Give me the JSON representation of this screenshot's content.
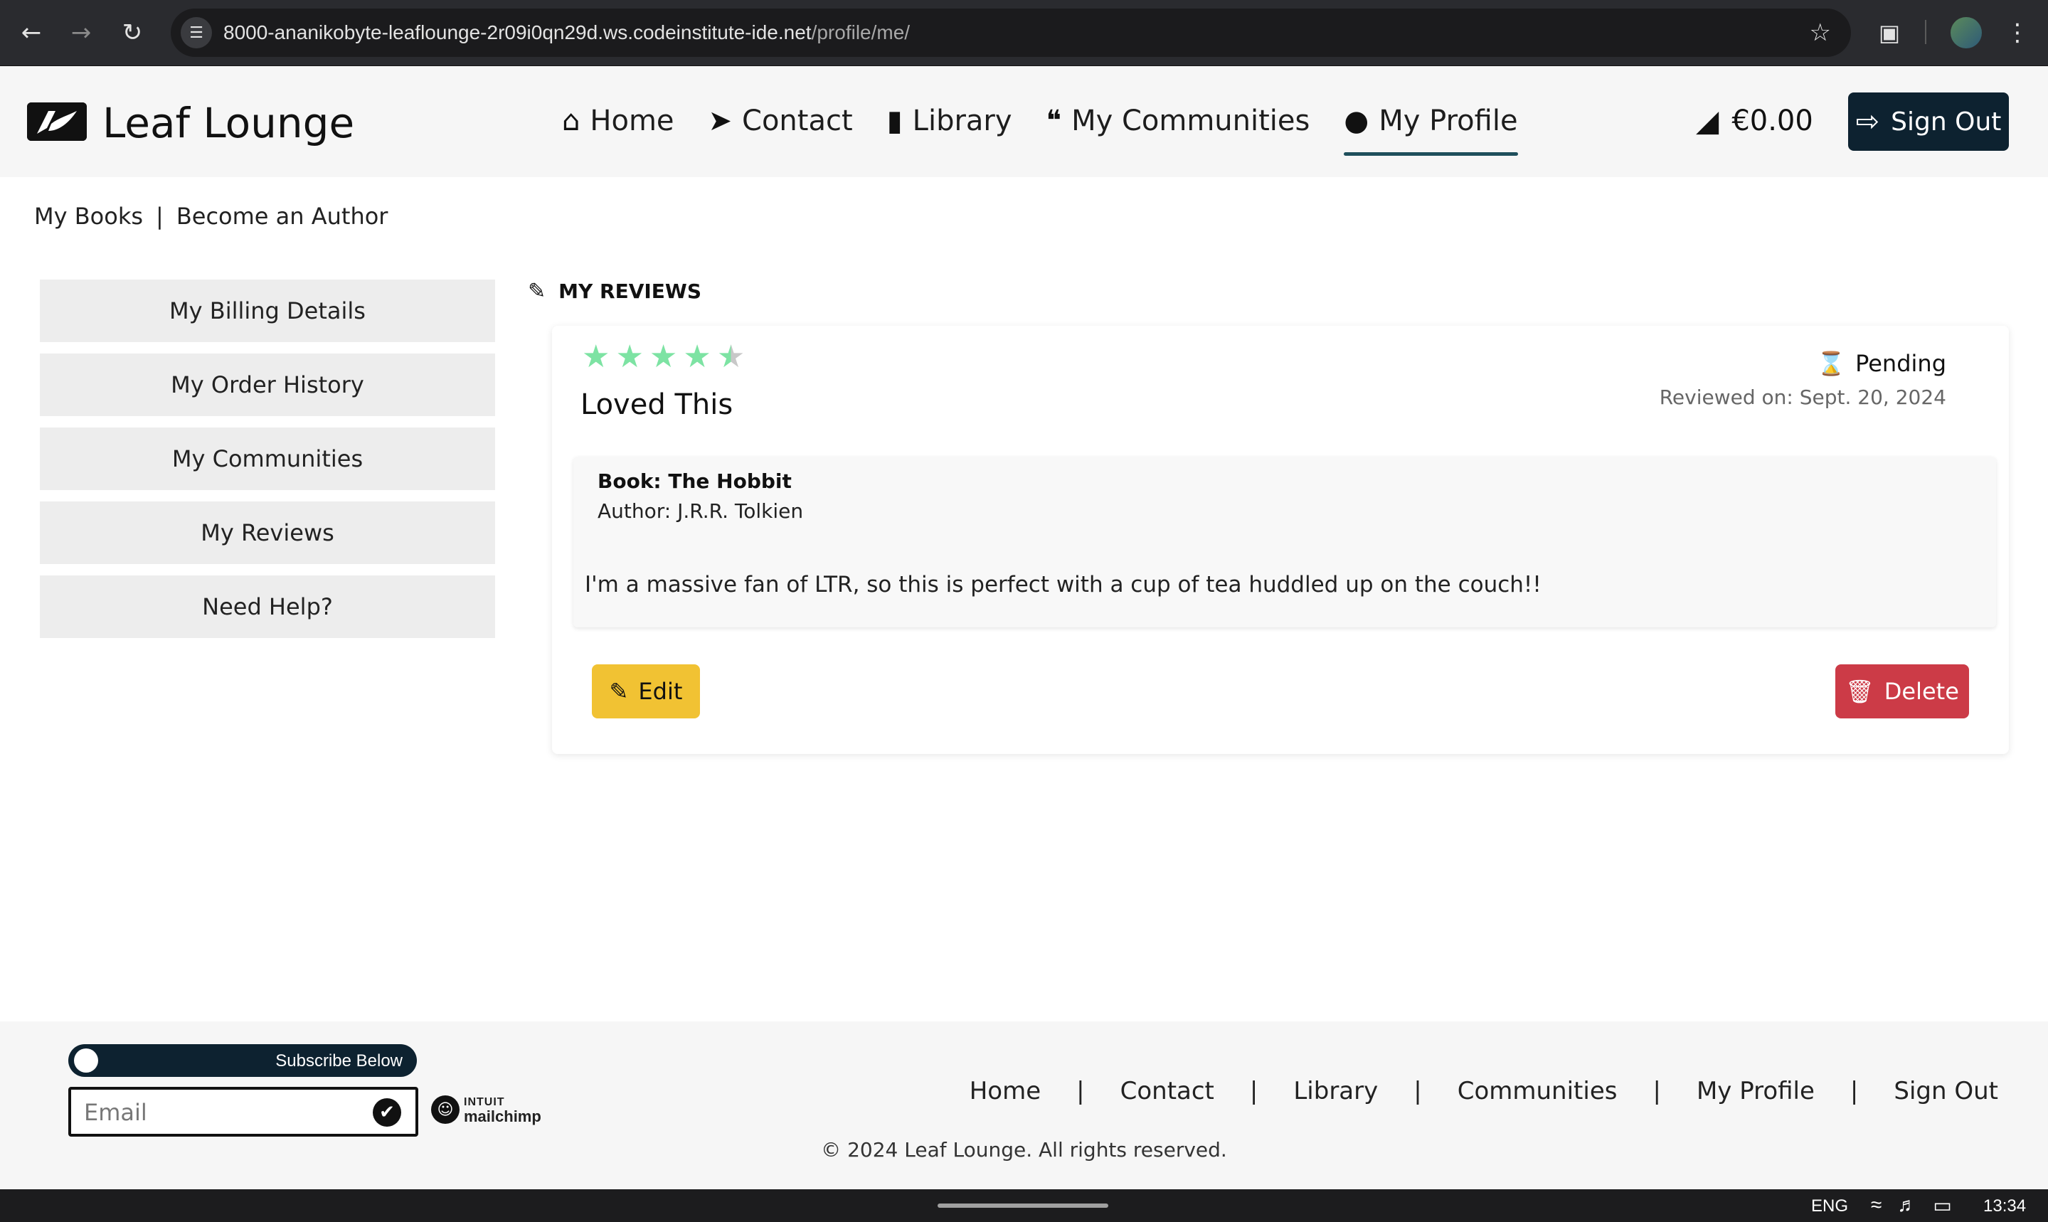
{
  "browser": {
    "url_host": "8000-ananikobyte-leaflounge-2r09i0qn29d.ws.codeinstitute-ide.net",
    "url_path": "/profile/me/"
  },
  "header": {
    "site_name": "Leaf Lounge",
    "nav": [
      {
        "label": "Home",
        "icon": "home-icon"
      },
      {
        "label": "Contact",
        "icon": "paper-plane-icon"
      },
      {
        "label": "Library",
        "icon": "book-icon"
      },
      {
        "label": "My Communities",
        "icon": "comments-icon"
      },
      {
        "label": "My Profile",
        "icon": "user-icon",
        "active": true
      }
    ],
    "cart_total": "€0.00",
    "signout_label": "Sign Out"
  },
  "subnav": {
    "my_books": "My Books",
    "separator": "|",
    "become_author": "Become an Author"
  },
  "sidebar": {
    "items": [
      {
        "label": "My Billing Details"
      },
      {
        "label": "My Order History"
      },
      {
        "label": "My Communities"
      },
      {
        "label": "My Reviews"
      },
      {
        "label": "Need Help?"
      }
    ]
  },
  "reviews": {
    "section_title": "MY REVIEWS",
    "items": [
      {
        "rating": 4.5,
        "rating_max": 5,
        "title": "Loved This",
        "status": "Pending",
        "reviewed_on": "Reviewed on: Sept. 20, 2024",
        "book": "Book: The Hobbit",
        "author": "Author: J.R.R. Tolkien",
        "text": "I'm a massive fan of LTR, so this is perfect with a cup of tea huddled up on the couch!!",
        "edit_label": "Edit",
        "delete_label": "Delete"
      }
    ]
  },
  "footer": {
    "subscribe_label": "Subscribe Below",
    "email_placeholder": "Email",
    "mailchimp_top": "INTUIT",
    "mailchimp_bottom": "mailchimp",
    "links": [
      "Home",
      "Contact",
      "Library",
      "Communities",
      "My Profile",
      "Sign Out"
    ],
    "link_separator": "|",
    "copyright": "© 2024 Leaf Lounge. All rights reserved."
  },
  "taskbar": {
    "lang": "ENG",
    "time": "13:34"
  },
  "colors": {
    "accent_dark": "#0d2230",
    "nav_underline": "#1f4f5c",
    "star": "#7de3a3",
    "edit": "#f1c233",
    "delete": "#cc3b47"
  }
}
